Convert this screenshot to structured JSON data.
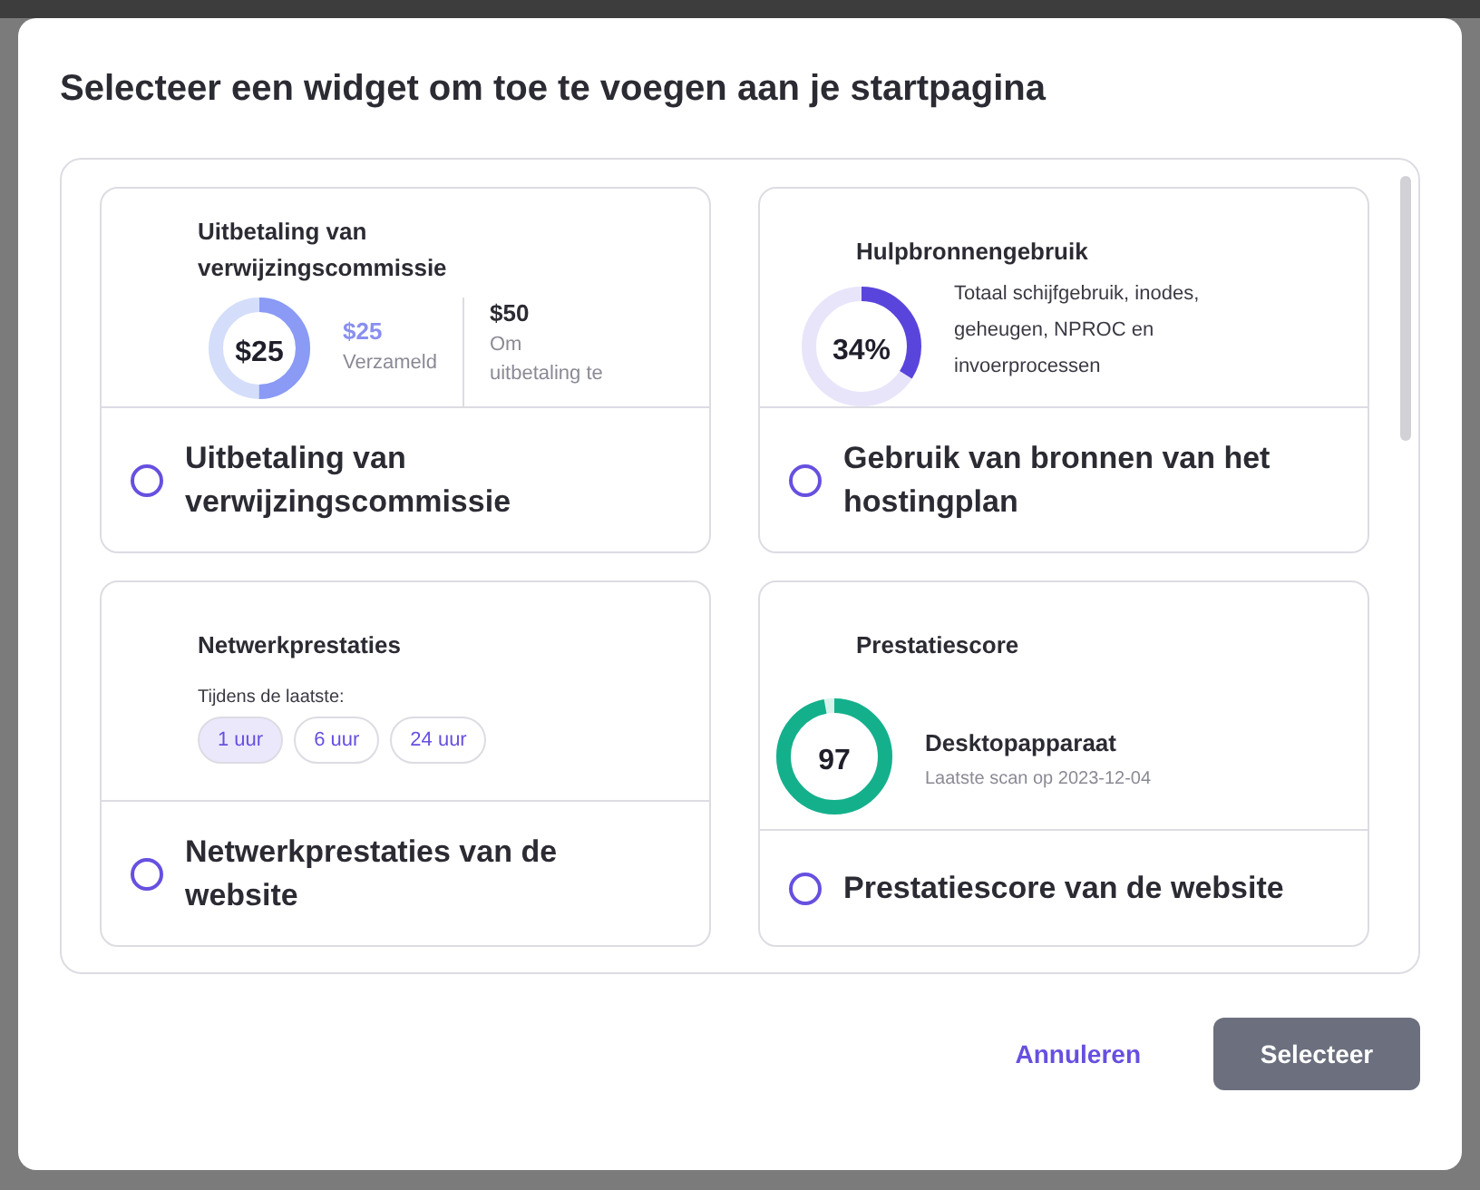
{
  "dialog": {
    "title": "Selecteer een widget om toe te voegen aan je startpagina"
  },
  "widgets": [
    {
      "kind": "referral",
      "title": "Uitbetaling van verwijzingscommissie",
      "gauge_text": "$25",
      "level": 0.5,
      "collected_amount": "$25",
      "collected_label": "Verzameld",
      "target_amount": "$50",
      "target_label_lines": [
        "Om",
        "uitbetaling te"
      ],
      "label": "Uitbetaling van verwijzingscommissie",
      "selected": false
    },
    {
      "kind": "resources",
      "title": "Hulpbronnengebruik",
      "gauge_text": "34%",
      "level": 0.34,
      "description": "Totaal schijfgebruik, inodes, geheugen, NPROC en invoerprocessen",
      "label": "Gebruik van bronnen van het hostingplan",
      "selected": false
    },
    {
      "kind": "network",
      "title": "Netwerkprestaties",
      "period_label": "Tijdens de laatste:",
      "periods": [
        {
          "label": "1 uur",
          "selected": true
        },
        {
          "label": "6 uur",
          "selected": false
        },
        {
          "label": "24 uur",
          "selected": false
        }
      ],
      "label": "Netwerkprestaties van de website",
      "selected": false
    },
    {
      "kind": "score",
      "title": "Prestatiescore",
      "gauge_text": "97",
      "level": 0.97,
      "device": "Desktopapparaat",
      "scan_note": "Laatste scan op 2023-12-04",
      "label": "Prestatiescore van de website",
      "selected": false
    }
  ],
  "footer": {
    "cancel": "Annuleren",
    "confirm": "Selecteer"
  }
}
